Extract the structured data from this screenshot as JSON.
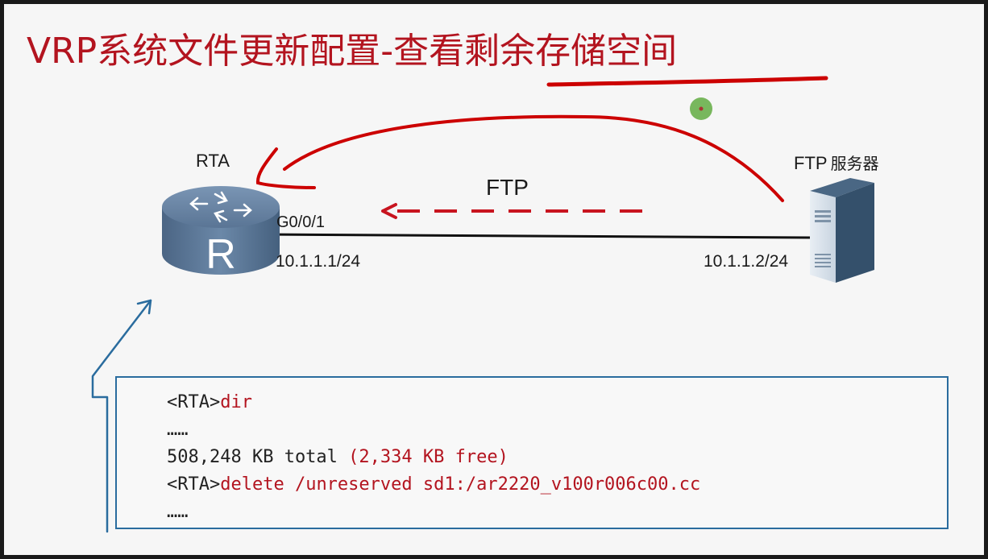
{
  "slide": {
    "title": "VRP系统文件更新配置-查看剩余存储空间"
  },
  "topology": {
    "router": {
      "name": "RTA",
      "icon": "router-icon",
      "port": "G0/0/1",
      "ip": "10.1.1.1/24"
    },
    "server": {
      "name": "FTP",
      "name_suffix": "服务器",
      "icon": "server-icon",
      "ip": "10.1.1.2/24"
    },
    "link_protocol": "FTP",
    "colors": {
      "title": "#b3141f",
      "annotation": "#cc0000",
      "box_border": "#2a6c9e",
      "pointer": "#6ab04c"
    }
  },
  "cli": {
    "lines": [
      {
        "prompt": "<RTA>",
        "command": "dir"
      },
      {
        "text": "……"
      },
      {
        "text": "508,248 KB total ",
        "highlight": "(2,334 KB free)"
      },
      {
        "prompt": "<RTA>",
        "command": "delete /unreserved sd1:/ar2220_v100r006c00.cc"
      },
      {
        "text": "……"
      }
    ]
  }
}
